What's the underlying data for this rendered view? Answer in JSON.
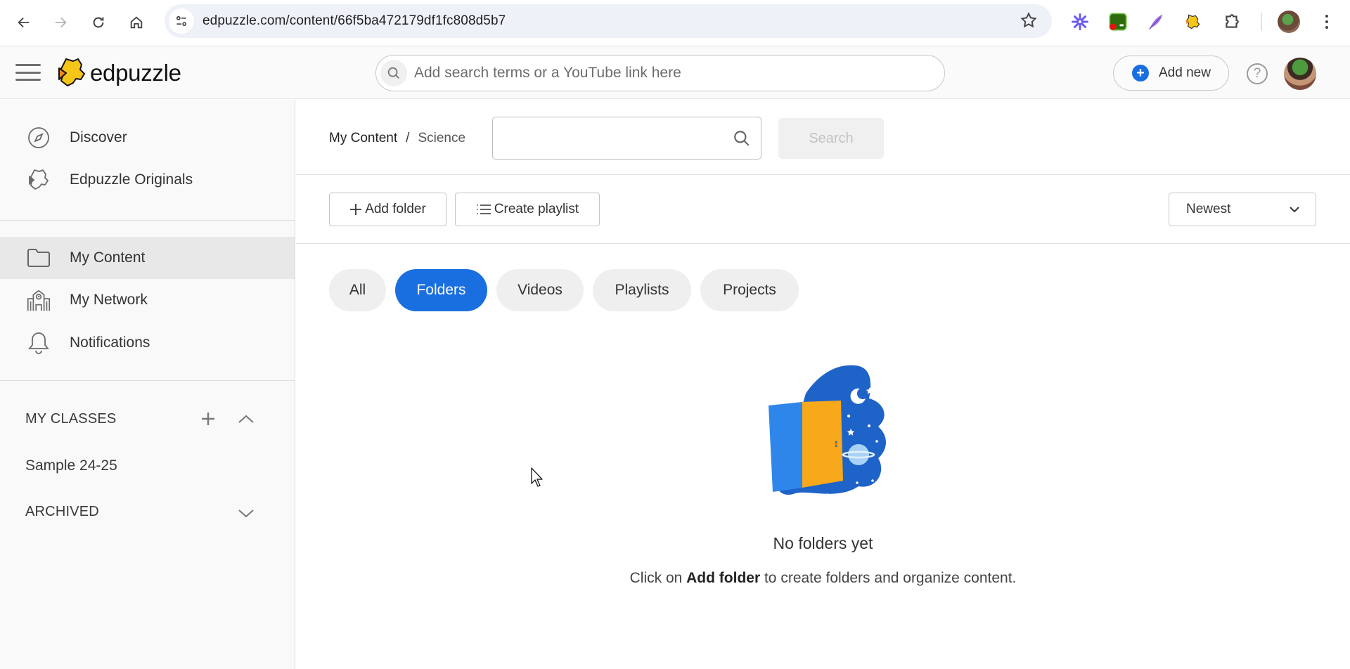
{
  "browser": {
    "url": "edpuzzle.com/content/66f5ba472179df1fc808d5b7",
    "nav": {
      "back_icon": "arrow-left",
      "forward_icon": "arrow-right",
      "reload_icon": "reload",
      "home_icon": "home"
    },
    "extensions": [
      "perplexity-icon",
      "screen-recorder-icon",
      "quill-icon",
      "edpuzzle-icon",
      "puzzle-extensions-icon"
    ]
  },
  "header": {
    "logo_text": "edpuzzle",
    "search_placeholder": "Add search terms or a YouTube link here",
    "add_new_label": "Add new",
    "help_glyph": "?"
  },
  "sidebar": {
    "top_items": [
      {
        "label": "Discover",
        "icon": "compass-icon"
      },
      {
        "label": "Edpuzzle Originals",
        "icon": "edpuzzle-puzzle-icon"
      }
    ],
    "nav_items": [
      {
        "label": "My Content",
        "icon": "folder-icon",
        "active": true
      },
      {
        "label": "My Network",
        "icon": "school-icon",
        "active": false
      },
      {
        "label": "Notifications",
        "icon": "bell-icon",
        "active": false
      }
    ],
    "my_classes_heading": "MY CLASSES",
    "classes": [
      "Sample 24-25"
    ],
    "archived_heading": "ARCHIVED"
  },
  "main": {
    "breadcrumb": {
      "root": "My Content",
      "separator": "/",
      "current": "Science"
    },
    "folder_search": {
      "value": "",
      "placeholder": ""
    },
    "search_button": "Search",
    "add_folder_label": "Add folder",
    "create_playlist_label": "Create playlist",
    "sort": {
      "selected": "Newest"
    },
    "filter_tabs": [
      {
        "label": "All",
        "active": false
      },
      {
        "label": "Folders",
        "active": true
      },
      {
        "label": "Videos",
        "active": false
      },
      {
        "label": "Playlists",
        "active": false
      },
      {
        "label": "Projects",
        "active": false
      }
    ],
    "empty_state": {
      "title": "No folders yet",
      "sub_prefix": "Click on ",
      "sub_bold": "Add folder",
      "sub_suffix": " to create folders and organize content."
    }
  },
  "colors": {
    "accent": "#1a6fe0",
    "sidebar_bg": "#f9f9f9",
    "active_item_bg": "#e8e8e8",
    "logo_yellow": "#f5c518",
    "illustration_blue": "#1e63c8",
    "door_orange": "#f7a81b"
  }
}
